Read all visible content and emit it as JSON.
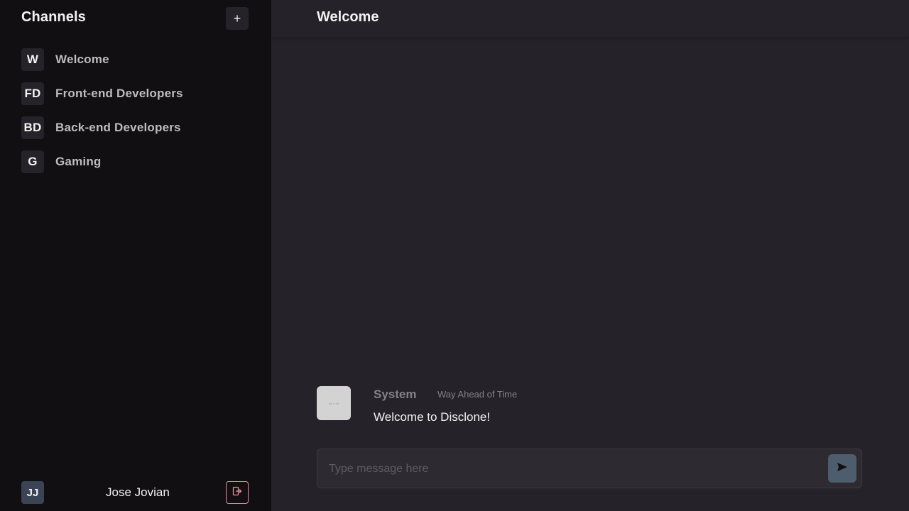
{
  "sidebar": {
    "title": "Channels",
    "add_button_label": "+",
    "channels": [
      {
        "initials": "W",
        "name": "Welcome"
      },
      {
        "initials": "FD",
        "name": "Front-end Developers"
      },
      {
        "initials": "BD",
        "name": "Back-end Developers"
      },
      {
        "initials": "G",
        "name": "Gaming"
      }
    ],
    "user": {
      "initials": "JJ",
      "name": "Jose Jovian",
      "logout_icon": "logout-icon"
    }
  },
  "main": {
    "channel_title": "Welcome",
    "messages": [
      {
        "author": "System",
        "time": "Way Ahead of Time",
        "text": "Welcome to Disclone!",
        "avatar_label": "48 x 48"
      }
    ],
    "composer": {
      "placeholder": "Type message here",
      "send_icon": "send-icon"
    }
  },
  "colors": {
    "sidebar_bg": "#120f13",
    "main_bg": "#252329",
    "send_button": "#4e5d6e",
    "logout_border": "#eb8a9a"
  }
}
